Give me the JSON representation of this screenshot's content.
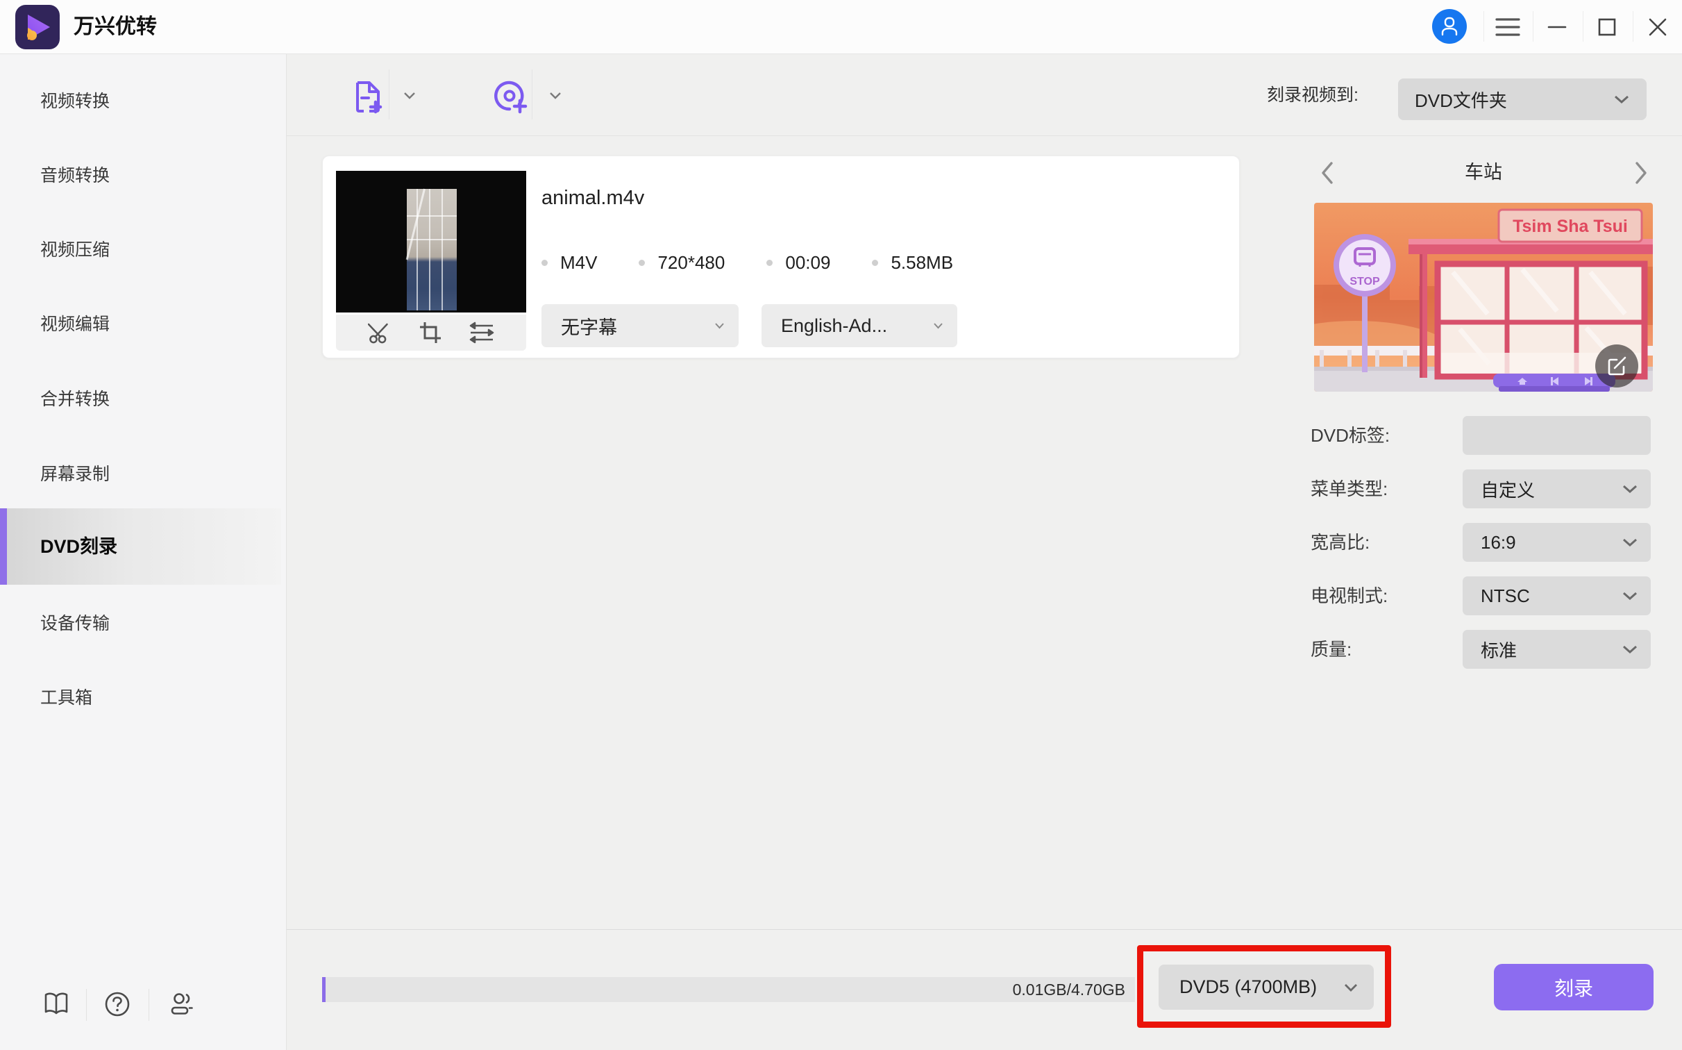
{
  "app": {
    "title": "万兴优转"
  },
  "sidebar": {
    "items": [
      {
        "label": "视频转换",
        "active": false
      },
      {
        "label": "音频转换",
        "active": false
      },
      {
        "label": "视频压缩",
        "active": false
      },
      {
        "label": "视频编辑",
        "active": false
      },
      {
        "label": "合并转换",
        "active": false
      },
      {
        "label": "屏幕录制",
        "active": false
      },
      {
        "label": "DVD刻录",
        "active": true
      },
      {
        "label": "设备传输",
        "active": false
      },
      {
        "label": "工具箱",
        "active": false
      }
    ]
  },
  "toolbar": {
    "burn_to_label": "刻录视频到:",
    "burn_to_value": "DVD文件夹"
  },
  "file_card": {
    "filename": "animal.m4v",
    "meta": [
      "M4V",
      "720*480",
      "00:09",
      "5.58MB"
    ],
    "subtitle_value": "无字幕",
    "audio_value": "English-Ad..."
  },
  "template_panel": {
    "title": "车站",
    "illustration": {
      "sign_text": "Tsim Sha Tsui",
      "stop_text": "STOP"
    },
    "fields": [
      {
        "label": "DVD标签:",
        "type": "input",
        "value": ""
      },
      {
        "label": "菜单类型:",
        "type": "select",
        "value": "自定义"
      },
      {
        "label": "宽高比:",
        "type": "select",
        "value": "16:9"
      },
      {
        "label": "电视制式:",
        "type": "select",
        "value": "NTSC"
      },
      {
        "label": "质量:",
        "type": "select",
        "value": "标准"
      }
    ]
  },
  "bottom_bar": {
    "usage_text": "0.01GB/4.70GB",
    "disc_type_value": "DVD5 (4700MB)",
    "burn_button_label": "刻录"
  },
  "colors": {
    "accent_purple": "#8c6cf0",
    "annotation_red": "#ea1309",
    "avatar_blue": "#1677f0"
  }
}
